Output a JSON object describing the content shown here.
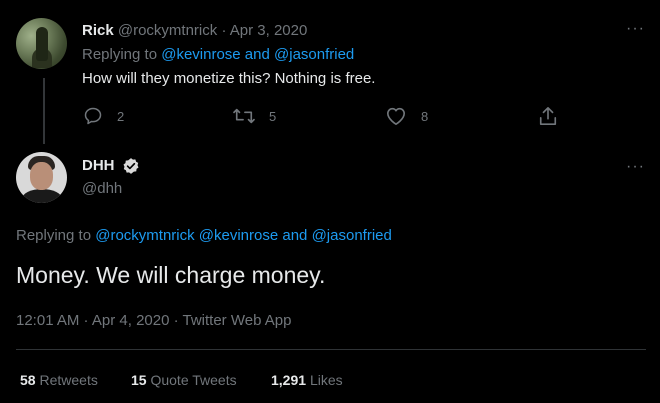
{
  "reply_tweet": {
    "display_name": "Rick",
    "handle": "@rockymtnrick",
    "separator": "·",
    "date": "Apr 3, 2020",
    "replying_prefix": "Replying to",
    "replying_mentions": "@kevinrose and @jasonfried",
    "text": "How will they monetize this? Nothing is free.",
    "actions": {
      "reply_count": "2",
      "retweet_count": "5",
      "like_count": "8"
    }
  },
  "main_tweet": {
    "display_name": "DHH",
    "handle": "@dhh",
    "replying_prefix": "Replying to",
    "replying_mentions": "@rockymtnrick @kevinrose and @jasonfried",
    "text": "Money. We will charge money.",
    "meta": "12:01 AM · Apr 4, 2020 · Twitter Web App",
    "stats": {
      "retweets_count": "58",
      "retweets_label": "Retweets",
      "quotes_count": "15",
      "quotes_label": "Quote Tweets",
      "likes_count": "1,291",
      "likes_label": "Likes"
    }
  },
  "more_glyph": "···",
  "colors": {
    "background": "#000000",
    "text": "#e7e9ea",
    "muted": "#71767b",
    "link": "#1d9bf0",
    "divider": "#2f3336"
  },
  "icons": [
    "reply-icon",
    "retweet-icon",
    "like-icon",
    "share-icon",
    "verified-badge-icon",
    "more-icon"
  ]
}
